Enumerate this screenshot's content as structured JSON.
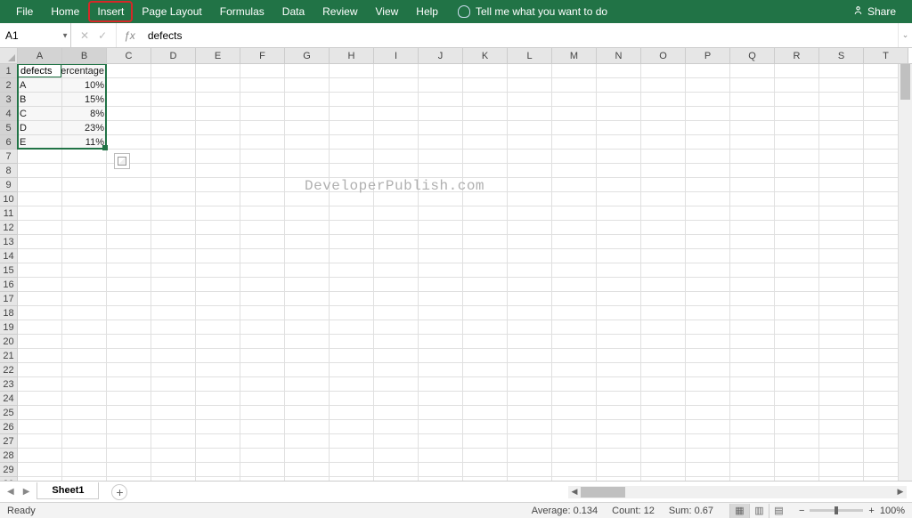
{
  "ribbon": {
    "tabs": [
      "File",
      "Home",
      "Insert",
      "Page Layout",
      "Formulas",
      "Data",
      "Review",
      "View",
      "Help"
    ],
    "highlighted_tab_index": 2,
    "tell_me": "Tell me what you want to do",
    "share": "Share"
  },
  "name_box": "A1",
  "formula_value": "defects",
  "columns": [
    "A",
    "B",
    "C",
    "D",
    "E",
    "F",
    "G",
    "H",
    "I",
    "J",
    "K",
    "L",
    "M",
    "N",
    "O",
    "P",
    "Q",
    "R",
    "S",
    "T"
  ],
  "col_widths": {
    "A": 50,
    "B": 50,
    "default": 50
  },
  "row_count": 30,
  "selected_cols": [
    0,
    1
  ],
  "selected_rows": [
    0,
    1,
    2,
    3,
    4,
    5
  ],
  "cells": {
    "A1": "defects",
    "B1": "percentage",
    "A2": "A",
    "B2": "10%",
    "A3": "B",
    "B3": "15%",
    "A4": "C",
    "B4": "8%",
    "A5": "D",
    "B5": "23%",
    "A6": "E",
    "B6": "11%"
  },
  "right_aligned_cols": [
    "B"
  ],
  "watermark": "DeveloperPublish.com",
  "sheet_tab": "Sheet1",
  "status": {
    "ready": "Ready",
    "average": "Average: 0.134",
    "count": "Count: 12",
    "sum": "Sum: 0.67",
    "zoom": "100%"
  }
}
